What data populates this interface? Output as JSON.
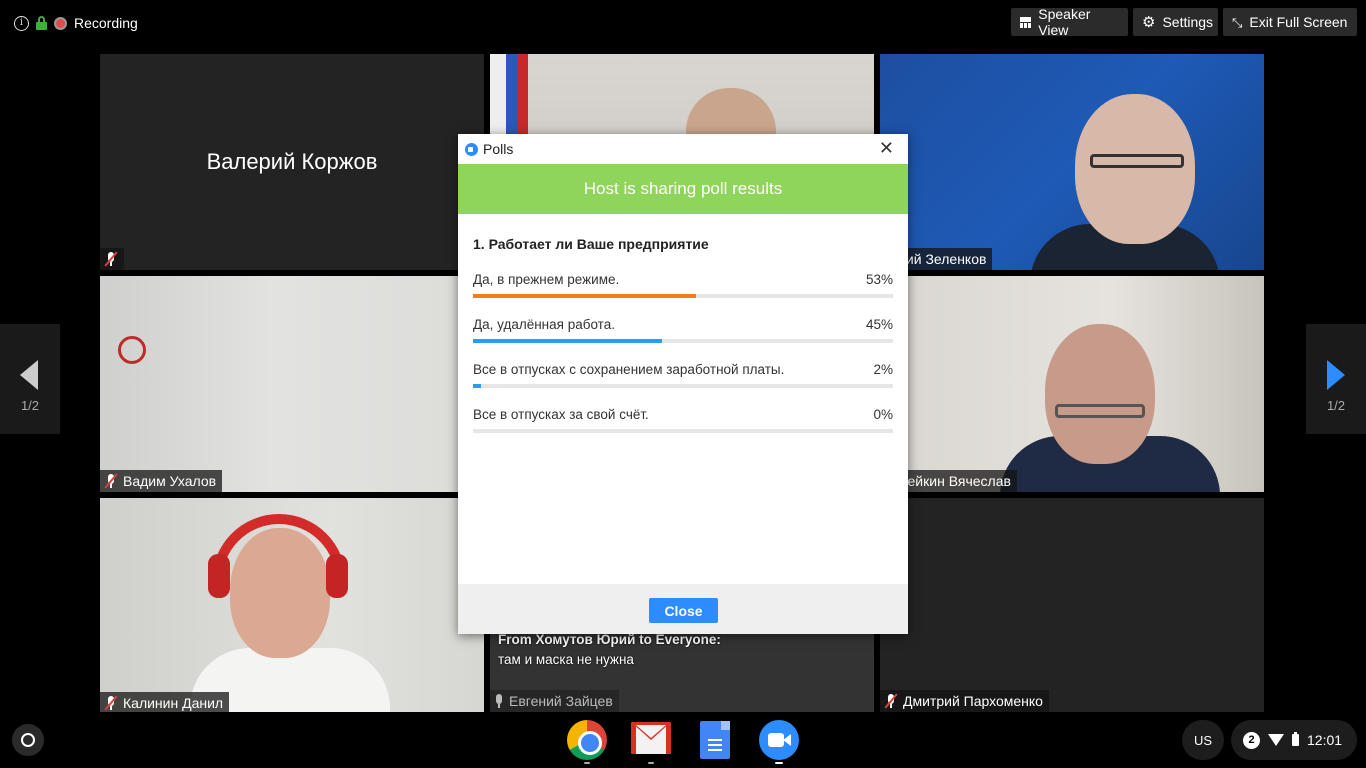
{
  "topbar": {
    "recording_label": "Recording",
    "speaker_view_label": "Speaker View",
    "settings_label": "Settings",
    "exit_fullscreen_label": "Exit Full Screen"
  },
  "participants": [
    {
      "name": "Валерий Коржов",
      "muted": true
    },
    {
      "name": "",
      "muted": false
    },
    {
      "name": "Юрий Зеленков",
      "muted": false
    },
    {
      "name": "Вадим Ухалов",
      "muted": true
    },
    {
      "name": "Копейкин Вячеслав",
      "muted": false
    },
    {
      "name": "Калинин Данил",
      "muted": true
    },
    {
      "name": "Евгений Зайцев",
      "muted": false
    },
    {
      "name": "Дмитрий Пархоменко",
      "muted": true
    }
  ],
  "chat": {
    "from": "From Хомутов Юрий to Everyone:",
    "message": "там и маска не нужна"
  },
  "pager": {
    "left": "1/2",
    "right": "1/2"
  },
  "poll": {
    "window_title": "Polls",
    "banner": "Host is sharing poll results",
    "question": "1. Работает ли Ваше предприятие",
    "answers": [
      {
        "text": "Да, в прежнем режиме.",
        "percent_label": "53%",
        "value": 53,
        "color": "#f07c1a"
      },
      {
        "text": "Да, удалённая работа.",
        "percent_label": "45%",
        "value": 45,
        "color": "#2d9cf0"
      },
      {
        "text": "Все в отпусках с сохранением заработной платы.",
        "percent_label": "2%",
        "value": 2,
        "color": "#2d9cf0"
      },
      {
        "text": "Все в отпусках за свой счёт.",
        "percent_label": "0%",
        "value": 0,
        "color": "#2d9cf0"
      }
    ],
    "close_label": "Close",
    "banner_color": "#8fd45b",
    "button_color": "#2d8cff"
  },
  "shelf": {
    "apps": [
      "chrome-icon",
      "gmail-icon",
      "docs-icon",
      "zoom-icon"
    ],
    "ime": "US",
    "notification_count": "2",
    "time": "12:01"
  }
}
